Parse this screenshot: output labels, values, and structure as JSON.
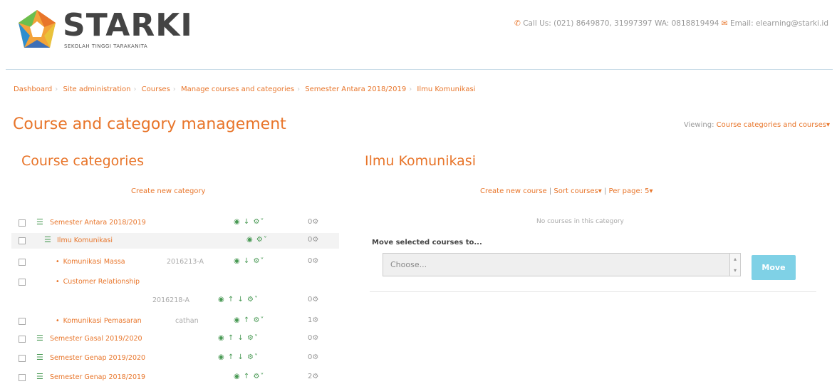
{
  "header": {
    "brand": "STARKI",
    "brand_sub": "SEKOLAH TINGGI TARAKANITA",
    "call_text": "Call Us: (021) 8649870, 31997397 WA: 0818819494",
    "email_text": "Email: elearning@starki.id",
    "phone_icon": "phone-icon",
    "mail_icon": "mail-icon"
  },
  "breadcrumb": [
    "Dashboard",
    "Site administration",
    "Courses",
    "Manage courses and categories",
    "Semester Antara 2018/2019",
    "Ilmu Komunikasi"
  ],
  "page_title": "Course and category management",
  "viewing": {
    "label": "Viewing:",
    "value": "Course categories and courses"
  },
  "categories": {
    "heading": "Course categories",
    "create_label": "Create new category",
    "rows": [
      {
        "label": "Semester Antara 2018/2019",
        "idnumber": "",
        "count": "0",
        "icon": "folder-icon",
        "actions": "◉ ↓ ⚙˅"
      },
      {
        "label": "Ilmu Komunikasi",
        "idnumber": "",
        "count": "0",
        "icon": "folder-icon",
        "actions": "◉ ⚙˅"
      },
      {
        "label": "Komunikasi Massa",
        "idnumber": "2016213-A",
        "count": "0",
        "icon": "bullet",
        "actions": "◉ ↓ ⚙˅"
      },
      {
        "label": "Customer Relationship",
        "idnumber": "",
        "count": "",
        "icon": "bullet",
        "actions": ""
      },
      {
        "label": "",
        "idnumber": "2016218-A",
        "count": "0",
        "icon": "",
        "actions": "◉ ↑ ↓ ⚙˅"
      },
      {
        "label": "Komunikasi Pemasaran",
        "idnumber": "cathan",
        "count": "1",
        "icon": "bullet",
        "actions": "◉ ↑ ⚙˅"
      },
      {
        "label": "Semester Gasal 2019/2020",
        "idnumber": "",
        "count": "0",
        "icon": "folder-icon",
        "actions": "◉ ↑ ↓ ⚙˅"
      },
      {
        "label": "Semester Genap 2019/2020",
        "idnumber": "",
        "count": "0",
        "icon": "folder-icon",
        "actions": "◉ ↑ ↓ ⚙˅"
      },
      {
        "label": "Semester Genap 2018/2019",
        "idnumber": "",
        "count": "2",
        "icon": "folder-icon",
        "actions": "◉ ↑ ⚙˅"
      }
    ]
  },
  "courses": {
    "heading": "Ilmu Komunikasi",
    "create_course": "Create new course",
    "sort": "Sort courses",
    "per_page": "Per page: 5",
    "empty": "No courses in this category",
    "move_label": "Move selected courses to...",
    "select_value": "Choose...",
    "move_button": "Move"
  },
  "colors": {
    "accent": "#e8752a",
    "action": "#4a9a55",
    "button": "#7fd1e6"
  }
}
